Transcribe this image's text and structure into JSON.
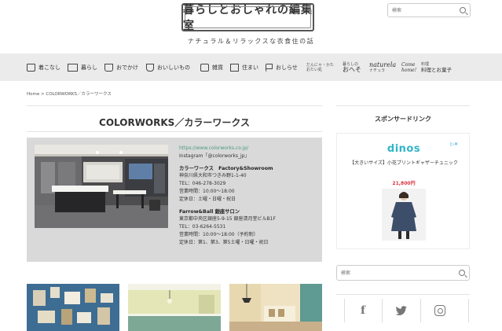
{
  "header": {
    "logo_text": "暮らしとおしゃれの編集室",
    "tagline": "ナチュラル＆リラックスな衣食住の話",
    "search_placeholder": "検索"
  },
  "nav": {
    "items": [
      {
        "label": "着こなし",
        "icon": "shirt-icon"
      },
      {
        "label": "暮らし",
        "icon": "book-icon"
      },
      {
        "label": "おでかけ",
        "icon": "bag-icon"
      },
      {
        "label": "おいしいもの",
        "icon": "cup-icon"
      },
      {
        "label": "雑貨",
        "icon": "notebook-icon"
      },
      {
        "label": "住まい",
        "icon": "house-icon"
      },
      {
        "label": "おしらせ",
        "icon": "flag-icon"
      }
    ],
    "special": {
      "item1_small1": "だんにゃ・かた",
      "item1_small2": "おたい処",
      "item2_small": "暮らしの",
      "item2_big": "おへそ",
      "item3": "naturela",
      "item3_small": "ナチュラ",
      "item4": "Come home!",
      "item5_small": "料理",
      "item5_big": "料理とお菓子"
    }
  },
  "breadcrumb": "Home > COLORWORKS／カラーワークス",
  "main": {
    "title": "COLORWORKS／カラーワークス",
    "info": {
      "url": "https://www.colorworks.co.jp/",
      "instagram": "Instagram「@colorworks_jp」",
      "s1_name": "カラーワークス　Factory&Showroom",
      "s1_address": "神奈川県大和市つきみ野1-1-40",
      "s1_tel": "TEL：046-278-3029",
      "s1_hours": "営業時間：10:00～18:00",
      "s1_closed": "定休日：土曜・日曜・祝日",
      "s2_name": "Farrow&Ball 銀座サロン",
      "s2_address": "東京都中央区銀座5-9-15 銀座清月堂ビルB1F",
      "s2_tel": "TEL：03-6264-5531",
      "s2_hours": "営業時間：10:00～18:00（予約制）",
      "s2_closed": "定休日：第1、第3、第5土曜・日曜・祝日"
    }
  },
  "sidebar": {
    "sponsor_title": "スポンサードリンク",
    "ad": {
      "brand": "dinos",
      "badge": "▷✕",
      "caption": "【大きいサイズ】小花プリントギャザーチュニック",
      "price": "21,800円"
    },
    "search_placeholder": "検索",
    "social": {
      "facebook": "f",
      "twitter": "twitter-bird",
      "instagram": "instagram-icon"
    }
  }
}
